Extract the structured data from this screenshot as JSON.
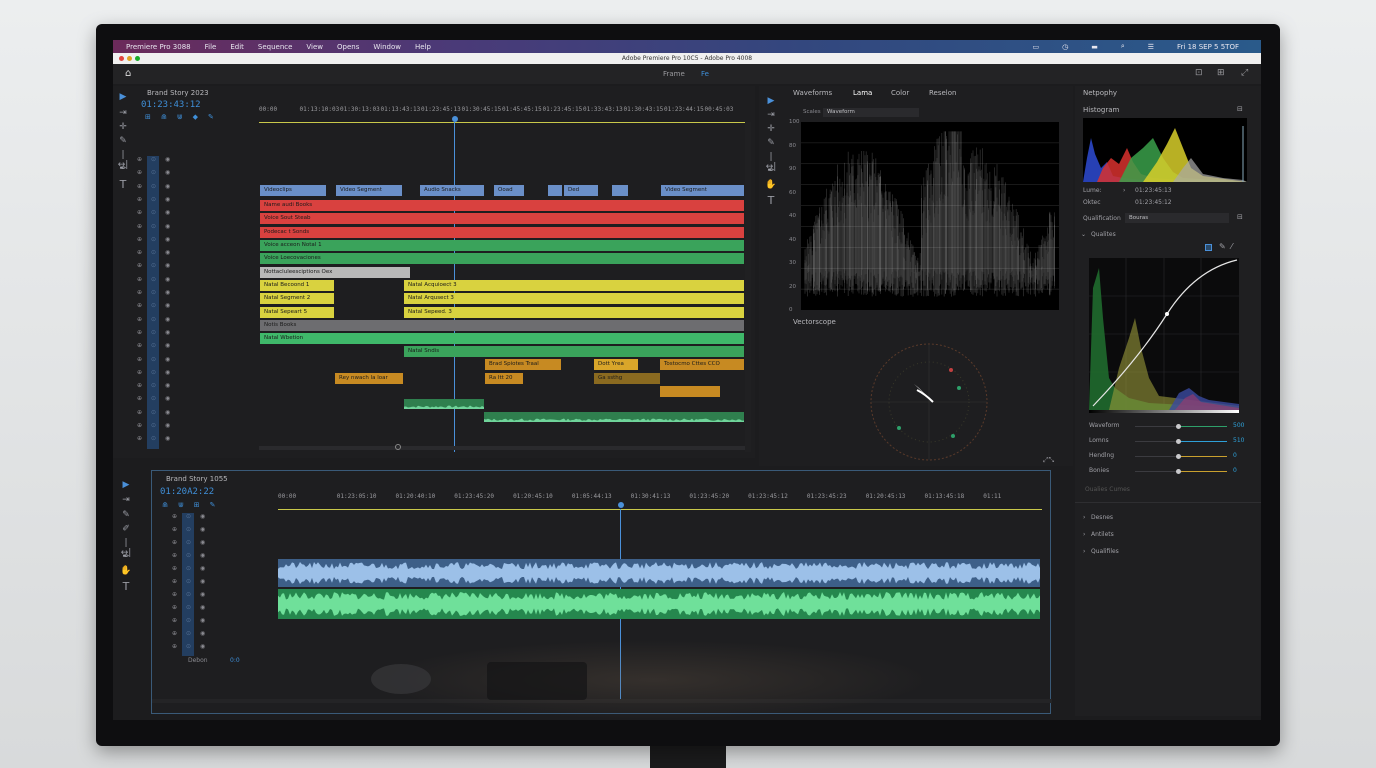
{
  "menubar": {
    "items": [
      "Premiere Pro 3088",
      "File",
      "Edit",
      "Sequence",
      "View",
      "Opens",
      "Window",
      "Help"
    ],
    "right_text": "Fri 18 SEP 5 5TOF"
  },
  "title": "Adobe Premiere Pro 10C5 - Adobe Pro 4008",
  "toolbar": {
    "tab_a": "Frame",
    "tab_b": "Fe"
  },
  "top_timeline": {
    "name": "Brand Story 2023",
    "timecode": "01:23:43:12",
    "ruler": [
      "00:00",
      "01:13:10:03",
      "01:30:13:03",
      "01:13:43:13",
      "01:23:45:13",
      "01:30:45:15",
      "01:45:45:15",
      "01:23:45:15",
      "01:33:43:13",
      "01:30:43:15",
      "01:23:44:15",
      "00:45:03"
    ],
    "clips": {
      "v1": [
        "Videoclips",
        "Video Segment",
        "Audio Snacks",
        "Ooad",
        "Ded",
        "Video Segment"
      ],
      "r1": "Name audi Books",
      "r2": "Voice Sout Steab",
      "r3": "Podecac t Sonds",
      "g1": "Voice acceon Notal 1",
      "g2": "Voice Loecovaciones",
      "gray1": "Nottacluleesciptions Oex",
      "y1": "Natal Becoond 1",
      "y2": "Natal Segment 2",
      "y3": "Natal Sepeart 5",
      "y4": "Natal Acquioect 3",
      "y5": "Natal Arqusect 3",
      "y6": "Natal Sepeed. 3",
      "darkgray": "Notis Books",
      "g3": "Natal Wbetion",
      "g4": "Natal Sndis",
      "o1": "Brad Spiotes Traal",
      "o2": "Dott Yrea",
      "o3": "Tostocmo Cttes CCO",
      "o4": "Rey nwach la loar",
      "o5": "Ra Itt 20",
      "o6": "Ga ssthg"
    }
  },
  "bottom_timeline": {
    "name": "Brand Story 1055",
    "timecode": "01:20A2:22",
    "ruler": [
      "00:00",
      "01:23:05:10",
      "01:20:40:10",
      "01:23:45:20",
      "01:20:45:10",
      "01:05:44:13",
      "01:30:41:13",
      "01:23:45:20",
      "01:23:45:12",
      "01:23:45:23",
      "01:20:45:13",
      "01:13:45:18",
      "01:11"
    ],
    "track_label": "Debon",
    "track_value": "0:0"
  },
  "scopes": {
    "tabs": [
      "Waveforms",
      "Lama",
      "Color",
      "Reselon"
    ],
    "sub_label": "Scales",
    "sub_select": "Waveform",
    "y_labels": [
      "100",
      "80",
      "90",
      "60",
      "40",
      "40",
      "30",
      "20",
      "0"
    ],
    "vectorscope_label": "Vectorscope"
  },
  "inspector": {
    "title": "Netpophy",
    "histogram_label": "Histogram",
    "lume_label": "Lume:",
    "lume_value": "01:23:45:13",
    "offset_label": "Oktec",
    "offset_value": "01:23:45:12",
    "qualification_label": "Qualification",
    "qualification_value": "Bouras",
    "section": "Qualites",
    "sliders": [
      {
        "label": "Waveform",
        "value": "500"
      },
      {
        "label": "Lomns",
        "value": "510"
      },
      {
        "label": "Hendlng",
        "value": "0"
      },
      {
        "label": "Bonies",
        "value": "0"
      }
    ],
    "hidden_row": "Oualies Cumes",
    "collapsed": [
      "Desnes",
      "Antilets",
      "Qualifiles"
    ]
  },
  "colors": {
    "red": "#d9413f",
    "green": "#3aa35b",
    "yellow": "#d9d23f",
    "blue_clip": "#6a8fc8",
    "orange": "#c78a22",
    "gray": "#b8b8b8",
    "timecode": "#3f8fd8",
    "playhead": "#4a90d9"
  }
}
